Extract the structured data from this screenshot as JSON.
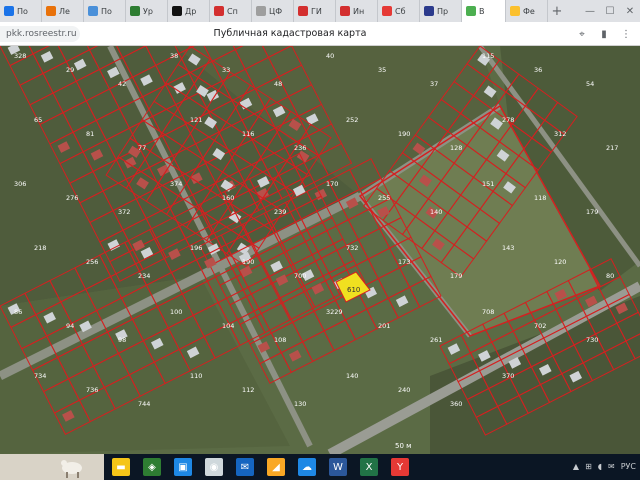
{
  "browser": {
    "tabs": [
      {
        "label": "По",
        "color": "#1a73e8"
      },
      {
        "label": "Ле",
        "color": "#e8710a"
      },
      {
        "label": "По",
        "color": "#4a90d9"
      },
      {
        "label": "Ур",
        "color": "#2e7d32"
      },
      {
        "label": "Др",
        "color": "#111111"
      },
      {
        "label": "Сп",
        "color": "#d32f2f"
      },
      {
        "label": "ЦФ",
        "color": "#9e9e9e"
      },
      {
        "label": "ГИ",
        "color": "#d32f2f"
      },
      {
        "label": "Ин",
        "color": "#d32f2f"
      },
      {
        "label": "Сб",
        "color": "#e53935"
      },
      {
        "label": "Пр",
        "color": "#2b3a8c"
      },
      {
        "label": "В",
        "color": "#4caf50"
      },
      {
        "label": "Фе",
        "color": "#fbc02d"
      }
    ],
    "active_tab_index": 11,
    "new_tab_glyph": "+",
    "controls": {
      "minimize": "—",
      "maximize": "☐",
      "close": "✕"
    },
    "url": "pkk.rosreestr.ru",
    "page_title": "Публичная кадастровая карта",
    "address_icons": [
      "location-icon",
      "bookmark-icon",
      "menu-icon"
    ]
  },
  "map": {
    "selected_parcel": "610",
    "parcel_color": "#d42020",
    "highlight_color": "#f0e020",
    "parcel_labels": [
      "328",
      "29",
      "42",
      "38",
      "33",
      "48",
      "40",
      "35",
      "37",
      "115",
      "36",
      "54",
      "65",
      "81",
      "77",
      "121",
      "116",
      "236",
      "252",
      "190",
      "128",
      "278",
      "312",
      "217",
      "306",
      "276",
      "372",
      "374",
      "160",
      "239",
      "170",
      "255",
      "140",
      "151",
      "118",
      "179",
      "218",
      "256",
      "234",
      "196",
      "190",
      "700",
      "732",
      "173",
      "179",
      "143",
      "120",
      "80",
      "86",
      "94",
      "98",
      "100",
      "104",
      "108",
      "3229",
      "201",
      "261",
      "708",
      "702",
      "730",
      "734",
      "736",
      "744",
      "110",
      "112",
      "130",
      "140",
      "240",
      "360",
      "370"
    ],
    "scale_label": "50 м"
  },
  "taskbar": {
    "apps": [
      {
        "name": "file-explorer-icon",
        "color": "#f5c518",
        "glyph": "▬"
      },
      {
        "name": "store-icon",
        "color": "#2e7d32",
        "glyph": "◈"
      },
      {
        "name": "photos-icon",
        "color": "#1e88e5",
        "glyph": "▣"
      },
      {
        "name": "camera-icon",
        "color": "#cfd8dc",
        "glyph": "◉"
      },
      {
        "name": "mail-icon",
        "color": "#1565c0",
        "glyph": "✉"
      },
      {
        "name": "paint-icon",
        "color": "#f9a825",
        "glyph": "◢"
      },
      {
        "name": "cloud-icon",
        "color": "#1e88e5",
        "glyph": "☁"
      },
      {
        "name": "word-icon",
        "color": "#2b579a",
        "glyph": "W"
      },
      {
        "name": "excel-icon",
        "color": "#217346",
        "glyph": "X"
      },
      {
        "name": "yandex-browser-icon",
        "color": "#e53935",
        "glyph": "Y"
      }
    ],
    "tray": [
      "▲",
      "⊞",
      "◖",
      "✉",
      "РУС"
    ]
  }
}
